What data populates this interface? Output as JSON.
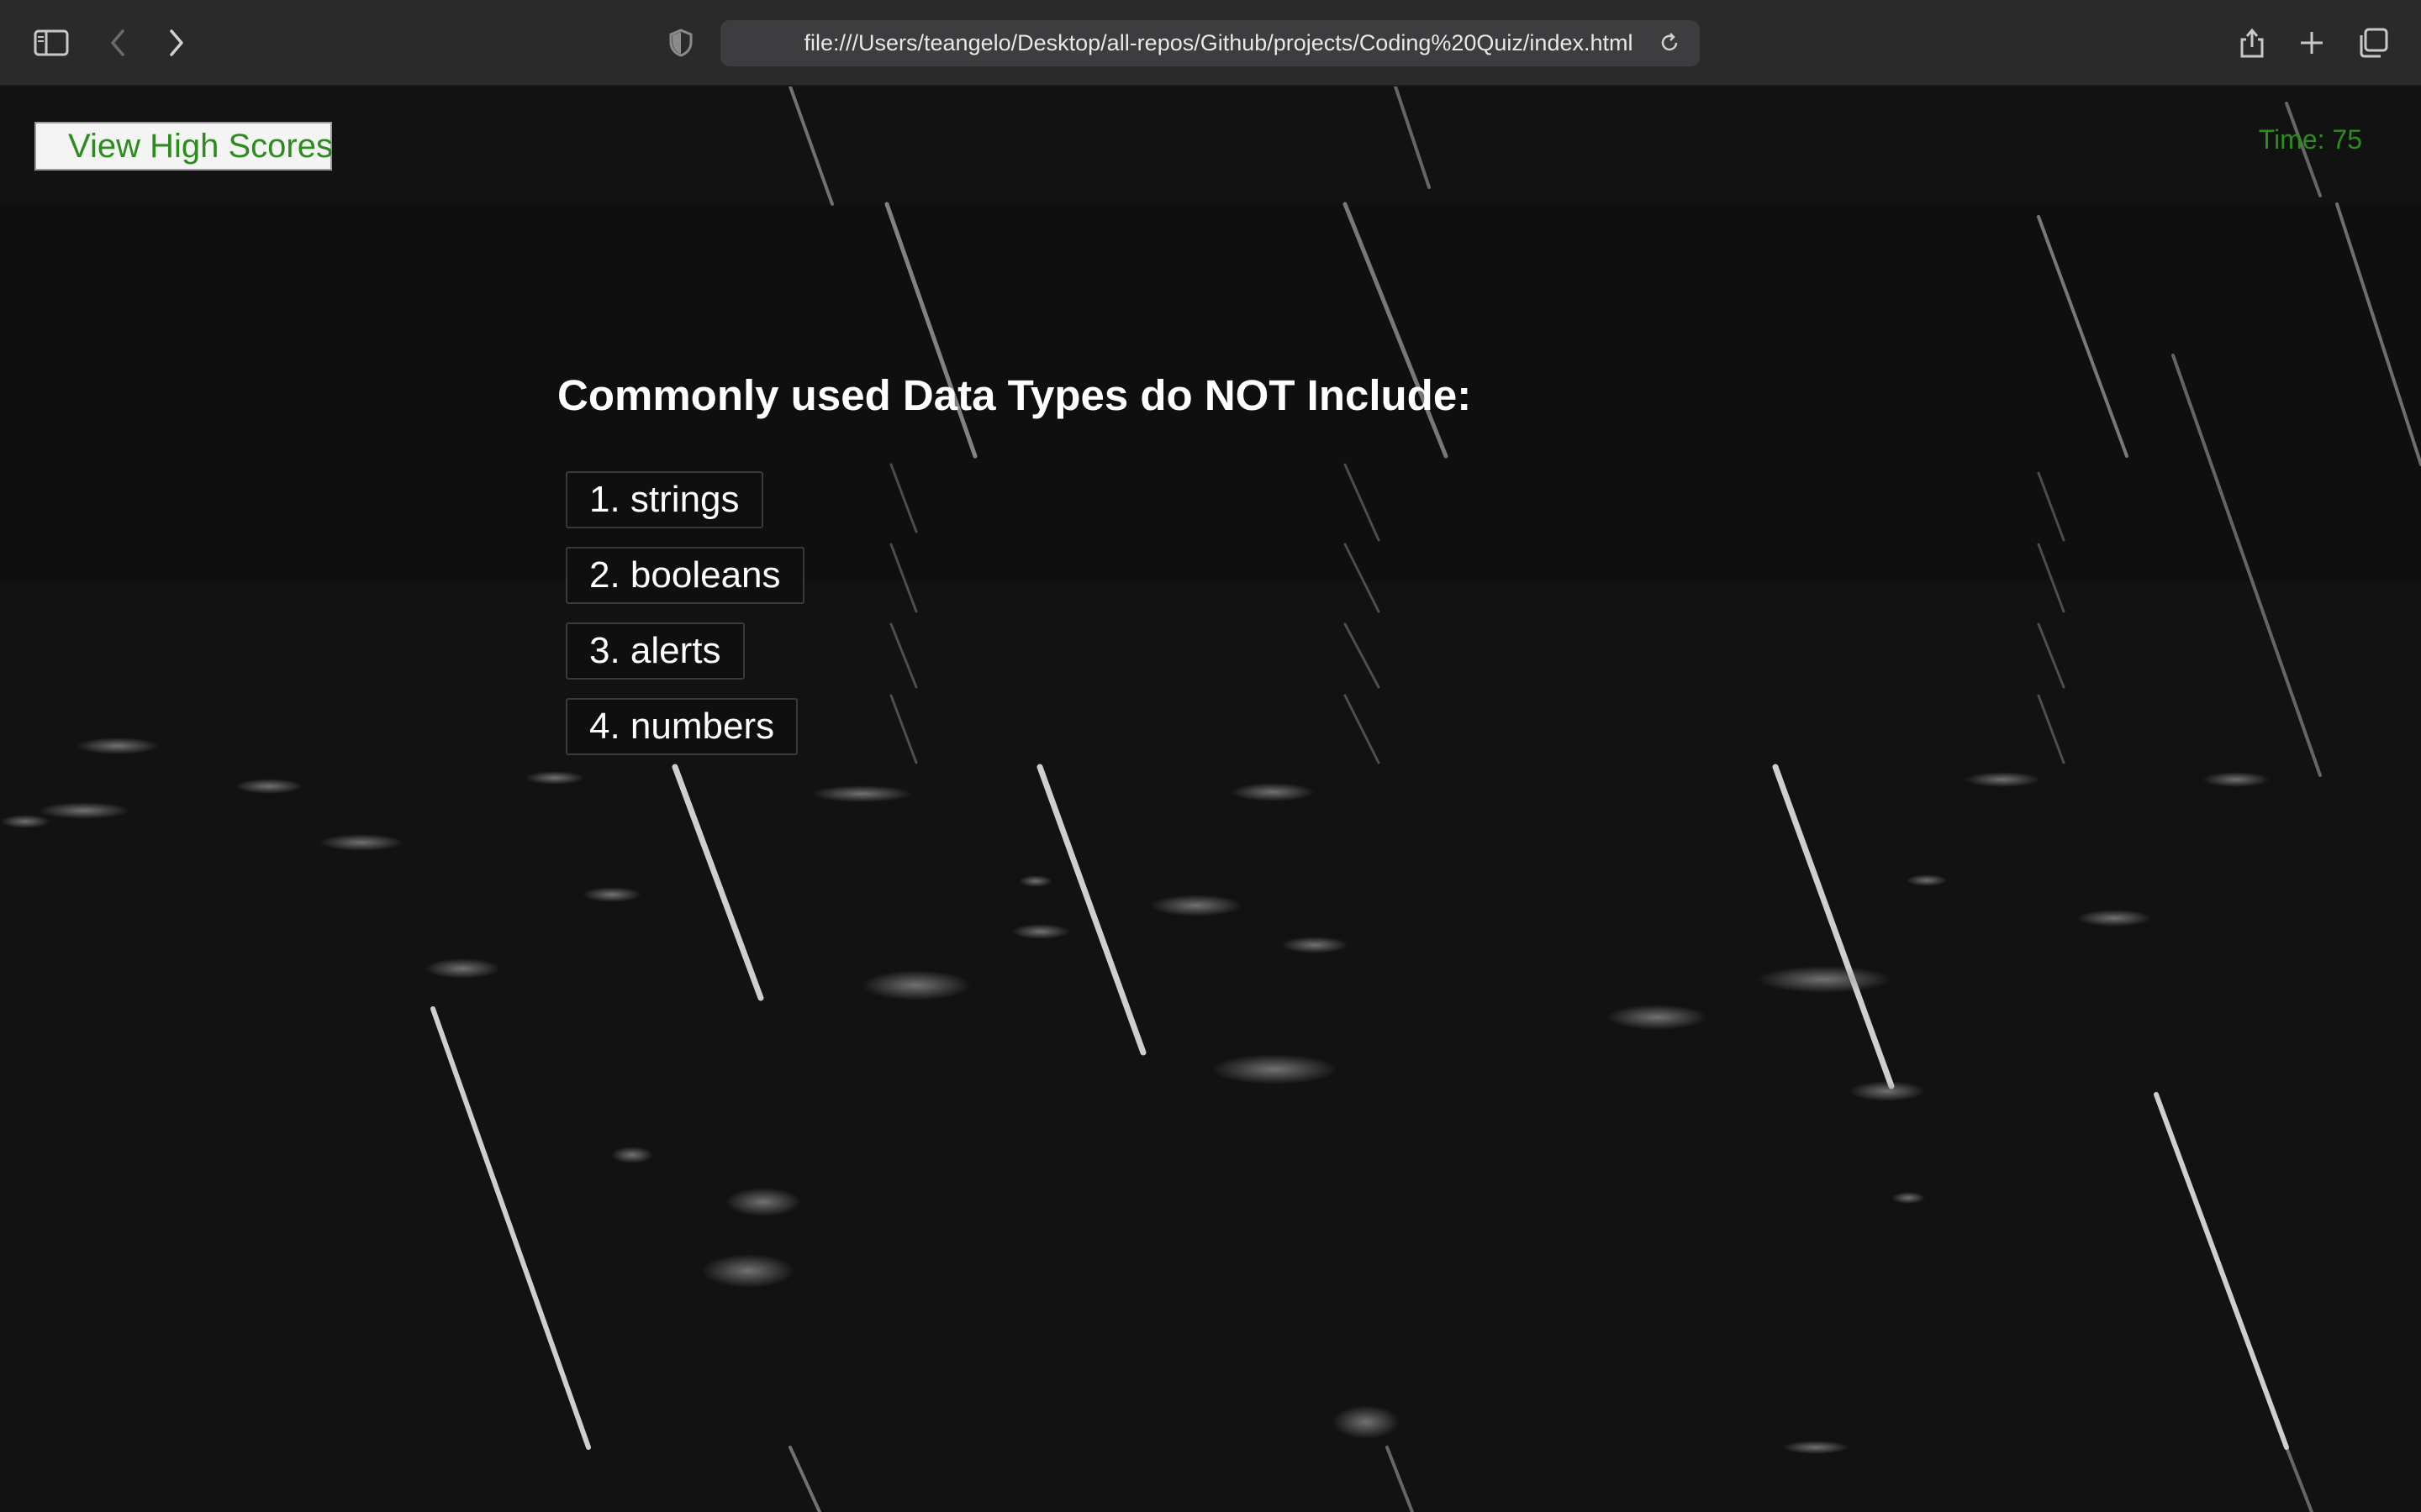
{
  "browser": {
    "url": "file:///Users/teangelo/Desktop/all-repos/Github/projects/Coding%20Quiz/index.html",
    "icons": {
      "sidebar": "sidebar-icon",
      "back": "chevron-left-icon",
      "forward": "chevron-right-icon",
      "privacy": "shield-icon",
      "reload": "reload-icon",
      "share": "share-icon",
      "new_tab": "plus-icon",
      "tabs": "tab-overview-icon"
    }
  },
  "page": {
    "high_scores_label": "View High Scores",
    "timer_text": "Time: 75",
    "question": "Commonly used Data Types do NOT Include:",
    "choices": [
      {
        "label": "1. strings"
      },
      {
        "label": "2. booleans"
      },
      {
        "label": "3. alerts"
      },
      {
        "label": "4. numbers"
      }
    ],
    "colors": {
      "accent_green": "#2e8b1f",
      "background": "#121212",
      "text": "#ffffff"
    }
  }
}
